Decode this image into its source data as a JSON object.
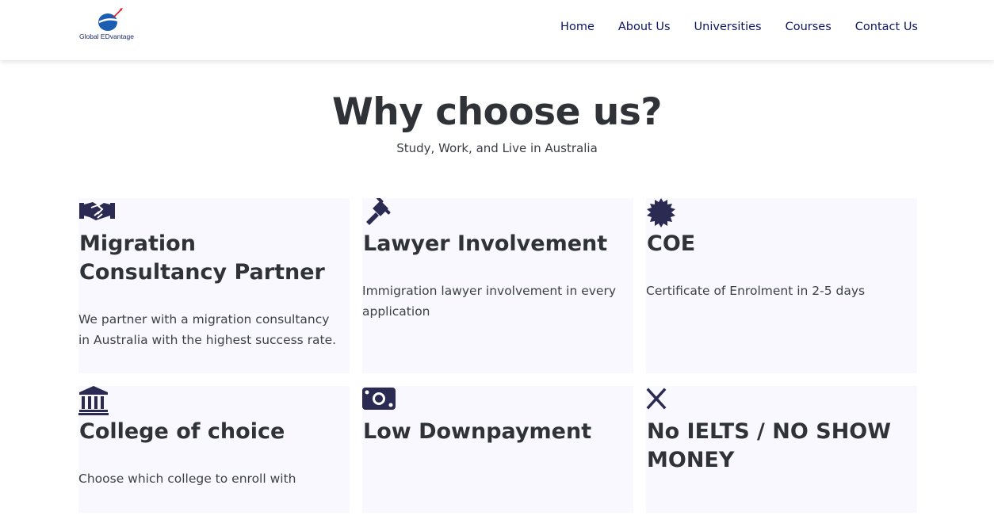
{
  "brand": {
    "logo_text": "Global EDvantage",
    "accent": "#0b1560",
    "icon_color": "#2a2a52"
  },
  "nav": {
    "items": [
      {
        "label": "Home"
      },
      {
        "label": "About Us"
      },
      {
        "label": "Universities"
      },
      {
        "label": "Courses"
      },
      {
        "label": "Contact Us"
      }
    ]
  },
  "hero": {
    "title": "Why choose us?",
    "subtitle": "Study, Work, and Live in Australia"
  },
  "features": [
    {
      "icon": "handshake-icon",
      "title": "Migration Consultancy Partner",
      "text": "We partner with a migration consultancy in Australia with the highest success rate."
    },
    {
      "icon": "gavel-icon",
      "title": "Lawyer Involvement",
      "text": "Immigration lawyer involvement in every application"
    },
    {
      "icon": "certificate-icon",
      "title": "COE",
      "text": "Certificate of Enrolment in 2-5 days"
    },
    {
      "icon": "university-icon",
      "title": "College of choice",
      "text": "Choose which college to enroll with"
    },
    {
      "icon": "money-bill-icon",
      "title": "Low Downpayment",
      "text": ""
    },
    {
      "icon": "times-icon",
      "title": "No IELTS / NO SHOW MONEY",
      "text": ""
    }
  ]
}
